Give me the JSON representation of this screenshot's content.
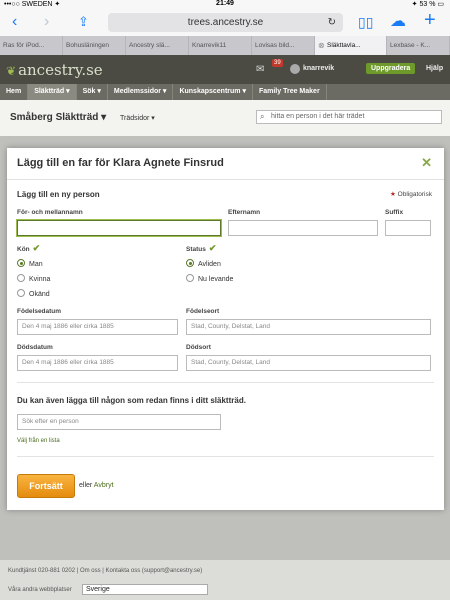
{
  "statusbar": {
    "carrier": "•••○○ SWEDEN ✦",
    "time": "21:49",
    "battery": "✦ 53 % ▭"
  },
  "browser": {
    "url": "trees.ancestry.se",
    "reload": "↻"
  },
  "tabs": [
    {
      "label": "Ras för iPod..."
    },
    {
      "label": "Bohusläningen"
    },
    {
      "label": "Ancestry slä..."
    },
    {
      "label": "Knarrevik11"
    },
    {
      "label": "Lovisas bild..."
    },
    {
      "label": "Släkttavla..."
    },
    {
      "label": "Lexbase - K..."
    }
  ],
  "site": {
    "logo": "ancestry.se",
    "notifications": "39",
    "username": "knarrevik",
    "upgrade": "Uppgradera",
    "help": "Hjälp"
  },
  "nav": [
    "Hem",
    "Släktträd ▾",
    "Sök ▾",
    "Medlemssidor ▾",
    "Kunskapscentrum ▾",
    "Family Tree Maker"
  ],
  "subheader": {
    "tree_title": "Småberg Släktträd ▾",
    "tree_pages": "Trädsidor ▾",
    "search_placeholder": "hitta en person i det här trädet"
  },
  "modal": {
    "title": "Lägg till en far för Klara Agnete Finsrud",
    "section_new": "Lägg till en ny person",
    "required": "Obligatorisk",
    "first_name_label": "För- och mellannamn",
    "last_name_label": "Efternamn",
    "suffix_label": "Suffix",
    "gender_label": "Kön",
    "gender_options": [
      "Man",
      "Kvinna",
      "Okänd"
    ],
    "gender_selected": "Man",
    "status_label": "Status",
    "status_options": [
      "Avliden",
      "Nu levande"
    ],
    "status_selected": "Avliden",
    "birth_date_label": "Födelsedatum",
    "birth_date_placeholder": "Den 4 maj 1886 eller cirka 1885",
    "birth_place_label": "Födelseort",
    "birth_place_placeholder": "Stad, County, Delstat, Land",
    "death_date_label": "Dödsdatum",
    "death_date_placeholder": "Den 4 maj 1886 eller cirka 1885",
    "death_place_label": "Dödsort",
    "death_place_placeholder": "Stad, County, Delstat, Land",
    "section_existing": "Du kan även lägga till någon som redan finns i ditt släktträd.",
    "existing_search_placeholder": "Sök efter en person",
    "choose_from_list": "Välj från en lista",
    "continue": "Fortsätt",
    "or": "eller",
    "cancel": "Avbryt"
  },
  "footer": {
    "contact": "Kundtjänst 020-881 0202  |  Om oss  |  Kontakta oss (support@ancestry.se)",
    "other_sites": "Våra andra webbplatser",
    "country": "Sverige"
  }
}
